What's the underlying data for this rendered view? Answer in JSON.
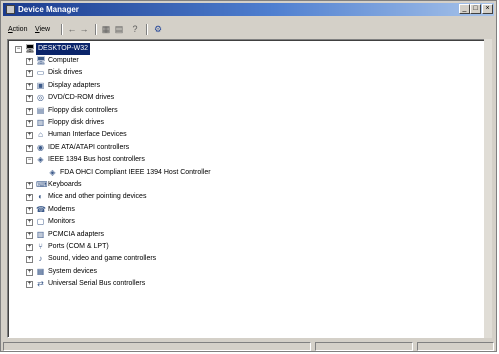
{
  "window": {
    "title": "Device Manager"
  },
  "menus": [
    "Action",
    "View"
  ],
  "toolbar": {
    "icons": [
      "back-arrow-icon",
      "forward-arrow-icon",
      "tree-view-icon",
      "properties-icon",
      "help-icon",
      "scan-hardware-icon"
    ]
  },
  "tree": {
    "root": "DESKTOP-W32",
    "categories": [
      {
        "label": "Computer",
        "icon": "computer-icon"
      },
      {
        "label": "Disk drives",
        "icon": "disk-drive-icon"
      },
      {
        "label": "Display adapters",
        "icon": "display-adapter-icon"
      },
      {
        "label": "DVD/CD-ROM drives",
        "icon": "cdrom-icon"
      },
      {
        "label": "Floppy disk controllers",
        "icon": "floppy-controller-icon"
      },
      {
        "label": "Floppy disk drives",
        "icon": "floppy-drive-icon"
      },
      {
        "label": "Human Interface Devices",
        "icon": "hid-icon"
      },
      {
        "label": "IDE ATA/ATAPI controllers",
        "icon": "ide-controller-icon"
      },
      {
        "label": "IEEE 1394 Bus host controllers",
        "icon": "ieee1394-icon",
        "expanded": true,
        "children": [
          {
            "label": "FDA OHCI Compliant IEEE 1394 Host Controller",
            "icon": "host-controller-icon"
          }
        ]
      },
      {
        "label": "Keyboards",
        "icon": "keyboard-icon"
      },
      {
        "label": "Mice and other pointing devices",
        "icon": "mouse-icon"
      },
      {
        "label": "Modems",
        "icon": "modem-icon"
      },
      {
        "label": "Monitors",
        "icon": "monitor-icon"
      },
      {
        "label": "PCMCIA adapters",
        "icon": "pcmcia-icon"
      },
      {
        "label": "Ports (COM & LPT)",
        "icon": "port-icon"
      },
      {
        "label": "Sound, video and game controllers",
        "icon": "sound-icon"
      },
      {
        "label": "System devices",
        "icon": "system-device-icon"
      },
      {
        "label": "Universal Serial Bus controllers",
        "icon": "usb-icon"
      }
    ]
  },
  "colors": {
    "titlebar": "#1a3a8c",
    "selection": "#0a246a",
    "chrome": "#d4d0c8"
  }
}
